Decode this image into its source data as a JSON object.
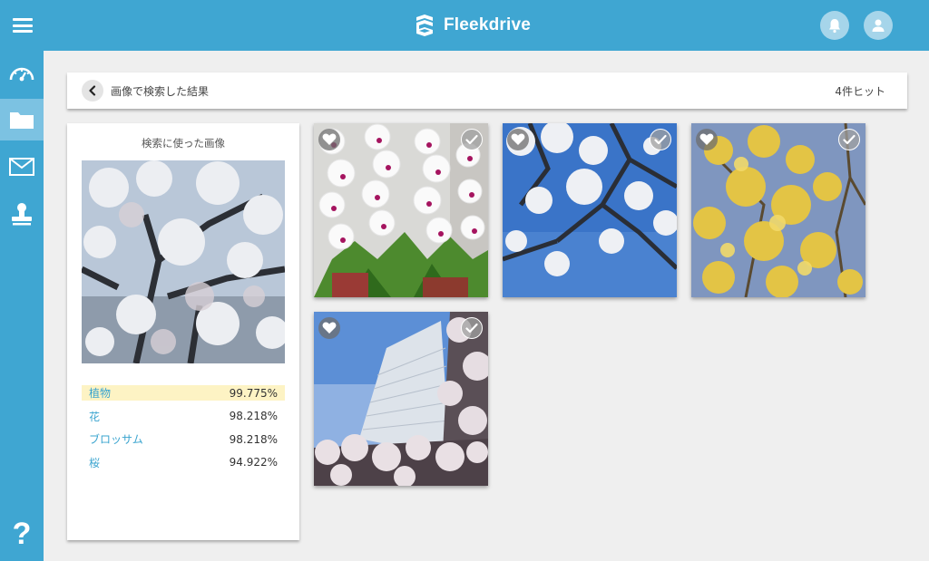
{
  "app": {
    "brand_name": "Fleekdrive",
    "icons": {
      "menu": "hamburger-icon",
      "logo": "fleekdrive-logo-icon",
      "notifications": "bell-icon",
      "account": "user-icon"
    }
  },
  "sidebar": {
    "items": [
      {
        "name": "dashboard",
        "icon": "speedometer-icon"
      },
      {
        "name": "files",
        "icon": "folder-icon",
        "active": true
      },
      {
        "name": "messages",
        "icon": "envelope-icon"
      },
      {
        "name": "approval",
        "icon": "stamp-icon"
      }
    ],
    "help_label": "?"
  },
  "header": {
    "back_icon": "chevron-left-icon",
    "title": "画像で検索した結果",
    "hit_count": "4件ヒット"
  },
  "query_panel": {
    "title": "検索に使った画像",
    "labels": [
      {
        "name": "植物",
        "score": "99.775%"
      },
      {
        "name": "花",
        "score": "98.218%"
      },
      {
        "name": "ブロッサム",
        "score": "98.218%"
      },
      {
        "name": "桜",
        "score": "94.922%"
      }
    ]
  },
  "results": {
    "tiles": [
      {
        "subject": "white orchids"
      },
      {
        "subject": "cherry blossoms and blue sky"
      },
      {
        "subject": "yellow blossoms"
      },
      {
        "subject": "building behind cherry blossoms"
      }
    ],
    "tile_icons": {
      "favorite": "heart-icon",
      "select": "check-icon"
    }
  },
  "colors": {
    "brand": "#3fa6d2",
    "sidebar_active": "#7cc2e2",
    "label_highlight": "#fdf3c4",
    "label_text": "#3aa4cf"
  }
}
